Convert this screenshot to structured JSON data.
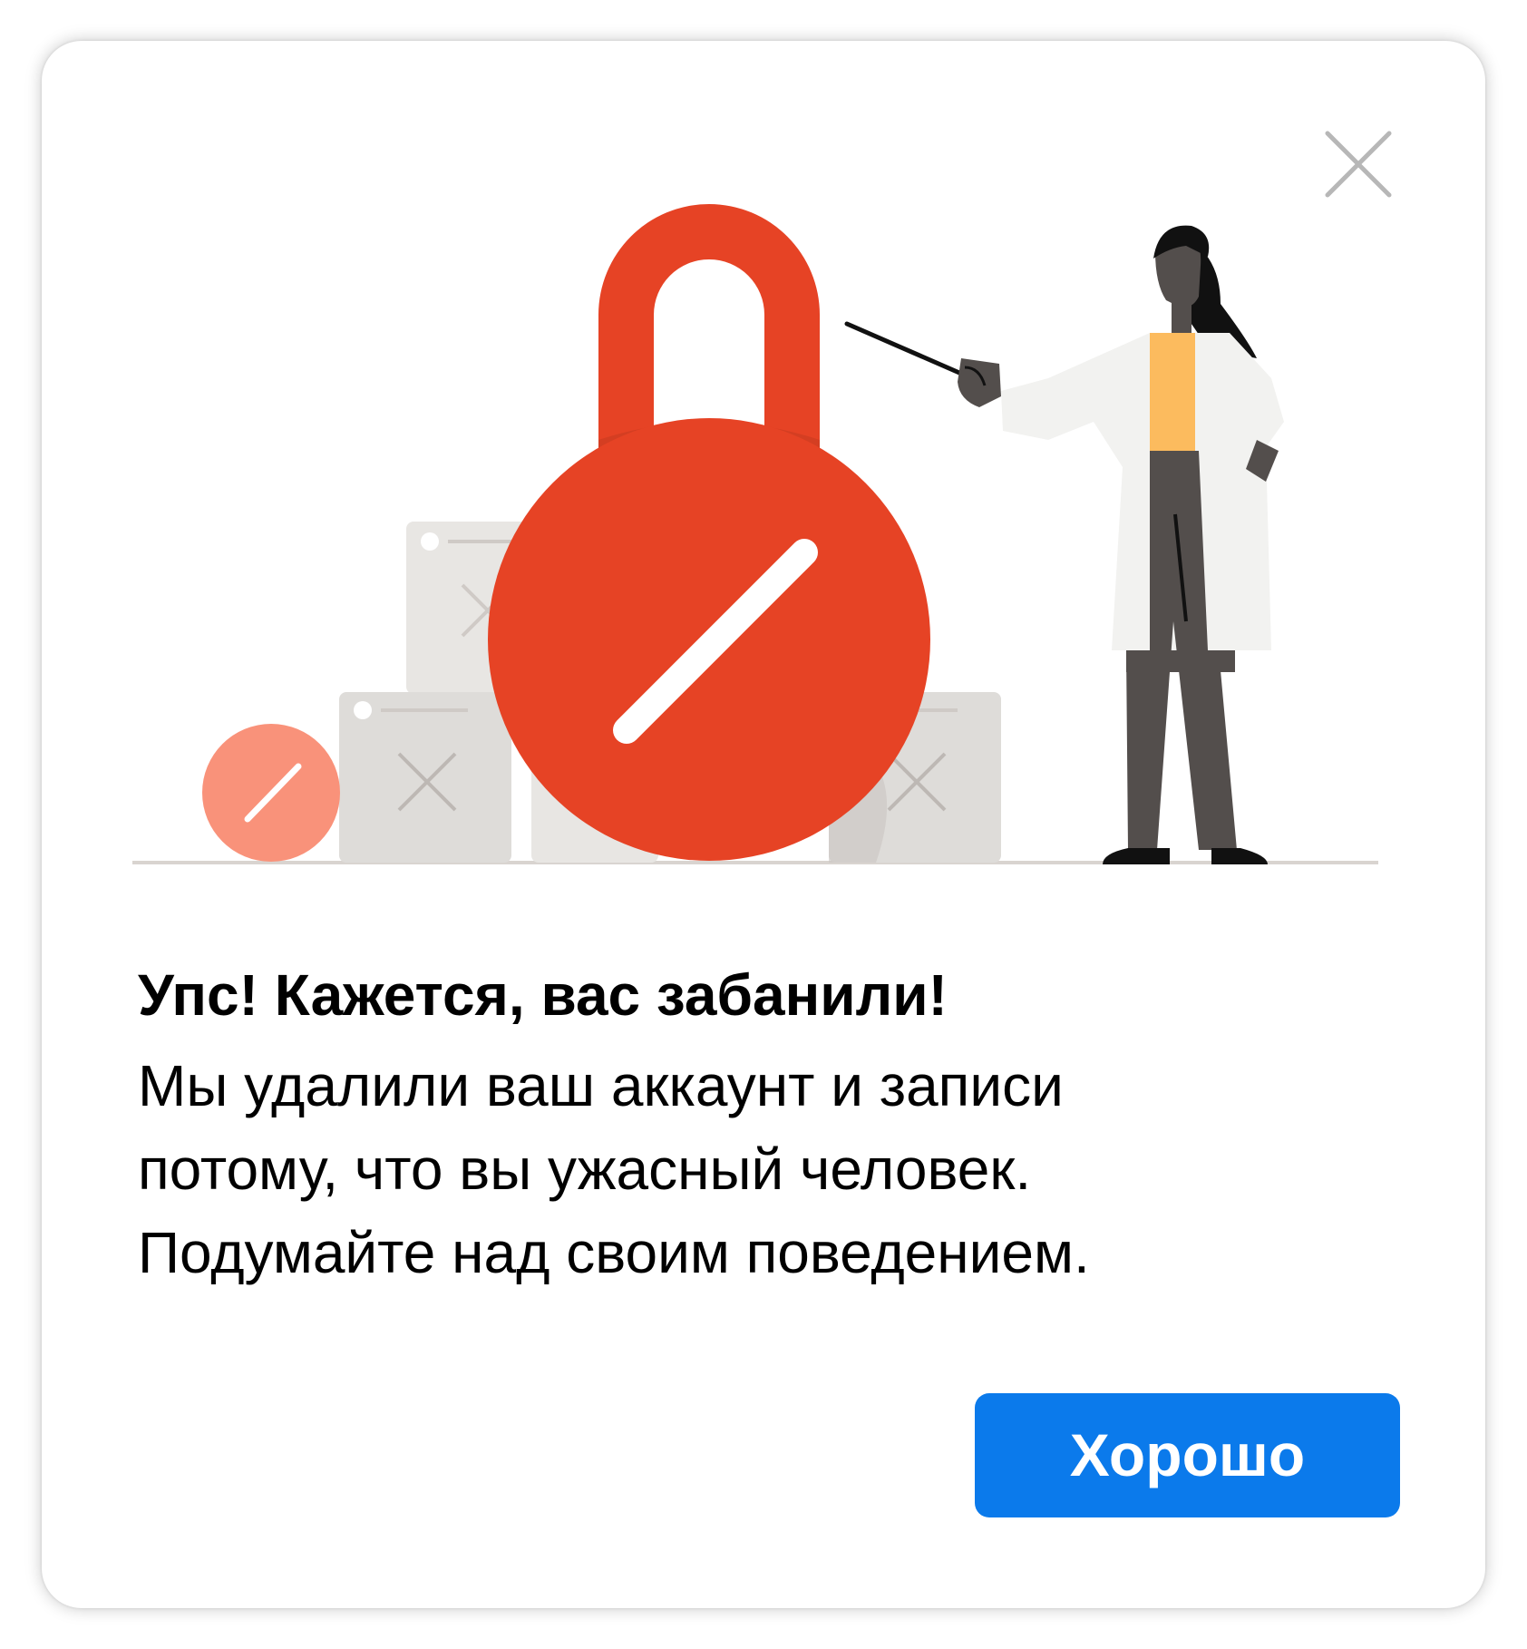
{
  "dialog": {
    "title": "Упс! Кажется, вас забанили!",
    "message": "Мы удалили ваш аккаунт и записи\nпотому, что вы ужасный человек.\nПодумайте над своим поведением.",
    "confirm_label": "Хорошо",
    "close_icon": "close-icon"
  },
  "illustration": {
    "subject": "padlock",
    "figure": "person",
    "colors": {
      "lock_red": "#e64325",
      "small_circle_salmon": "#f9927a",
      "box_gray": "#e3e1de",
      "coat_white": "#f2f2f0",
      "shirt_yellow": "#fcbb5e",
      "pants_gray": "#534e4c",
      "ground_line": "#d9d4d0"
    }
  },
  "colors": {
    "accent": "#0b7aeb",
    "text": "#000000",
    "close_icon": "#b7b7b7"
  }
}
